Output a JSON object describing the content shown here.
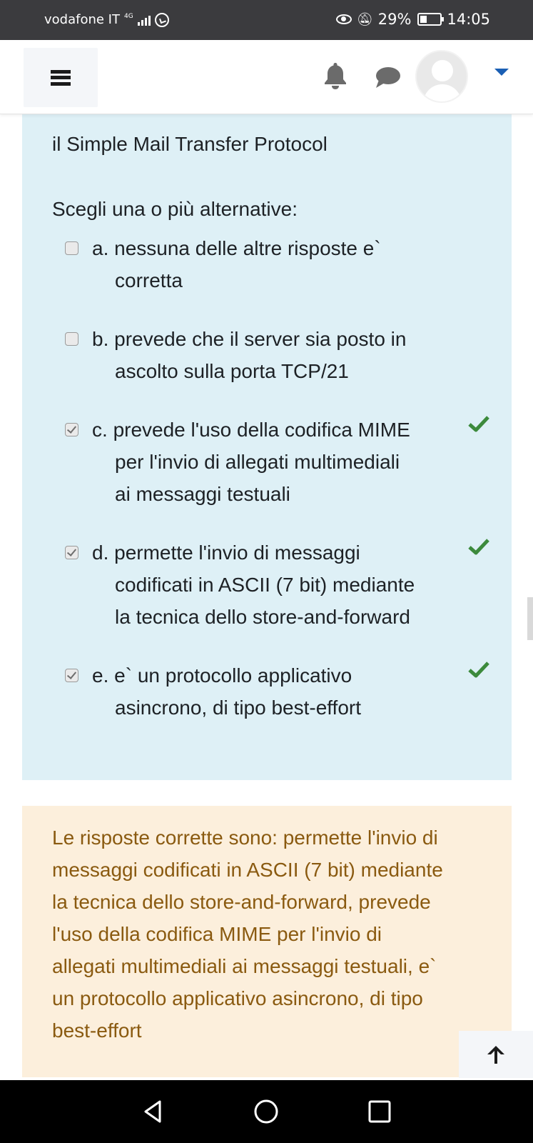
{
  "status_bar": {
    "carrier": "vodafone IT",
    "network": "4G",
    "battery_percent": "29%",
    "time": "14:05"
  },
  "header": {
    "menu_icon": "hamburger-icon",
    "notifications_icon": "bell-icon",
    "messages_icon": "chat-icon",
    "user_avatar_icon": "user-avatar-icon",
    "user_menu_icon": "caret-down-icon"
  },
  "question": {
    "text": "il Simple Mail Transfer Protocol",
    "prompt": "Scegli una o più alternative:",
    "answers": [
      {
        "letter": "a.",
        "lines": [
          "nessuna delle altre risposte e`",
          "corretta"
        ],
        "checked": false,
        "correct": false
      },
      {
        "letter": "b.",
        "lines": [
          "prevede che il server sia posto in",
          "ascolto sulla porta TCP/21"
        ],
        "checked": false,
        "correct": false
      },
      {
        "letter": "c.",
        "lines": [
          "prevede l'uso della codifica MIME",
          "per l'invio di allegati multimediali",
          "ai messaggi testuali"
        ],
        "checked": true,
        "correct": true
      },
      {
        "letter": "d.",
        "lines": [
          "permette l'invio di messaggi",
          "codificati in ASCII (7 bit) mediante",
          "la tecnica dello store-and-forward"
        ],
        "checked": true,
        "correct": true
      },
      {
        "letter": "e.",
        "lines": [
          "e` un protocollo applicativo",
          "asincrono, di tipo best-effort"
        ],
        "checked": true,
        "correct": true
      }
    ]
  },
  "feedback": {
    "lines": [
      "Le risposte corrette sono: permette l'invio di",
      "messaggi codificati in ASCII (7 bit) mediante",
      "la tecnica dello store-and-forward, prevede",
      "l'uso della codifica MIME per l'invio di",
      "allegati multimediali ai messaggi testuali, e`",
      "un protocollo applicativo asincrono, di tipo",
      "best-effort"
    ]
  },
  "back_to_top_icon": "arrow-up-icon",
  "colors": {
    "question_bg": "#def0f6",
    "feedback_bg": "#fcefdc",
    "feedback_text": "#8a5a10",
    "correct_tick": "#3c8a3c",
    "accent": "#1a5fb4"
  }
}
